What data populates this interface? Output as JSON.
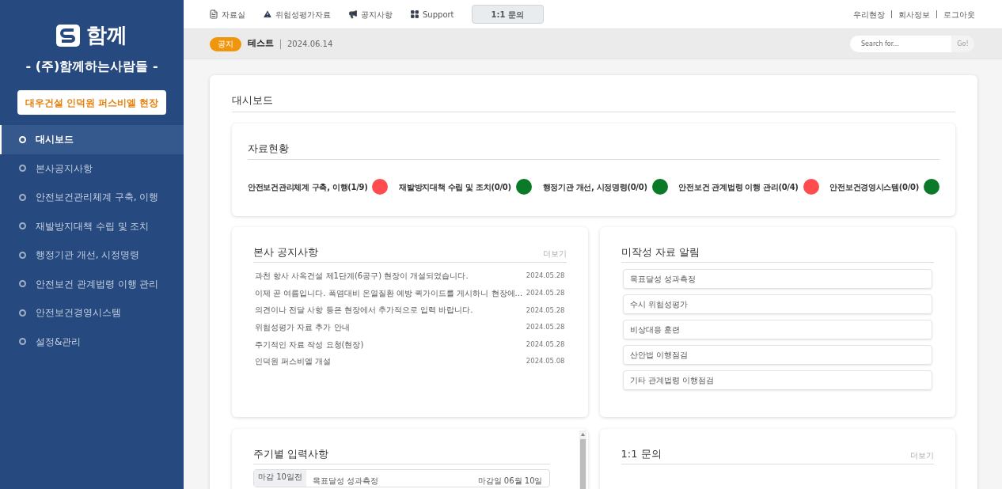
{
  "sidebar": {
    "logo_text": "함께",
    "company": "- (주)함께하는사람들 -",
    "site_button": "대우건설 인덕원 퍼스비엘 현장",
    "items": [
      {
        "label": "대시보드",
        "selected": true
      },
      {
        "label": "본사공지사항",
        "selected": false
      },
      {
        "label": "안전보건관리체계 구축, 이행",
        "selected": false
      },
      {
        "label": "재발방지대책 수립 및 조치",
        "selected": false
      },
      {
        "label": "행정기관 개선, 시정명령",
        "selected": false
      },
      {
        "label": "안전보건 관계법령 이행 관리",
        "selected": false
      },
      {
        "label": "안전보건경영시스템",
        "selected": false
      },
      {
        "label": "설정&관리",
        "selected": false
      }
    ]
  },
  "top_nav": [
    {
      "label": "자료실",
      "selected": false
    },
    {
      "label": "위험성평가자료",
      "selected": false
    },
    {
      "label": "공지사항",
      "selected": false
    },
    {
      "label": "Support",
      "selected": false
    },
    {
      "label": "1:1 문의",
      "selected": true
    }
  ],
  "top_links": [
    "우리현장",
    "회사정보",
    "로그아웃"
  ],
  "notice_bar": {
    "badge": "공지",
    "title": "테스트",
    "date": "2024.06.14"
  },
  "search": {
    "placeholder": "Search for...",
    "button": "Go!"
  },
  "dashboard": {
    "title": "대시보드",
    "status_panel": {
      "title": "자료현황",
      "items": [
        {
          "label": "안전보건관리체계 구축, 이행(1/9)",
          "color": "#ff4d4f"
        },
        {
          "label": "재발방지대책 수립 및 조치(0/0)",
          "color": "#0b7a28"
        },
        {
          "label": "행정기관 개선, 시정명령(0/0)",
          "color": "#0b7a28"
        },
        {
          "label": "안전보건 관계법령 이행 관리(0/4)",
          "color": "#ff4d4f"
        },
        {
          "label": "안전보건경영시스템(0/0)",
          "color": "#0b7a28"
        }
      ]
    },
    "notices": {
      "title": "본사 공지사항",
      "more": "더보기",
      "rows": [
        {
          "title": "과천 항사 사옥건설 제1단계(6공구) 현장이 개설되었습니다.",
          "date": "2024.05.28"
        },
        {
          "title": "이제 곧 여름입니다. 폭염대비 온열질환 예방 퀵가이드를 게시하니 현장에...",
          "date": "2024.05.28"
        },
        {
          "title": "의견이나 전달 사항 등은 현장에서 추가적으로 입력 바랍니다.",
          "date": "2024.05.28"
        },
        {
          "title": "위험성평가 자료 추가 안내",
          "date": "2024.05.28"
        },
        {
          "title": "주기적인 자료 작성 요청(현장)",
          "date": "2024.05.28"
        },
        {
          "title": "인덕원 퍼스비엘 개설",
          "date": "2024.05.08"
        }
      ]
    },
    "missing": {
      "title": "미작성 자료 알림",
      "items": [
        "목표달성 성과측정",
        "수시 위험성평가",
        "비상대응 훈련",
        "산안법 이행점검",
        "기타 관계법령 이행점검"
      ]
    },
    "periodic": {
      "title": "주기별 입력사항",
      "rows": [
        {
          "badge": "마감 10일전",
          "name": "목표달성 성과측정",
          "deadline": "마감일 06월 10일"
        }
      ]
    },
    "inquiry": {
      "title": "1:1 문의",
      "more": "더보기"
    }
  }
}
